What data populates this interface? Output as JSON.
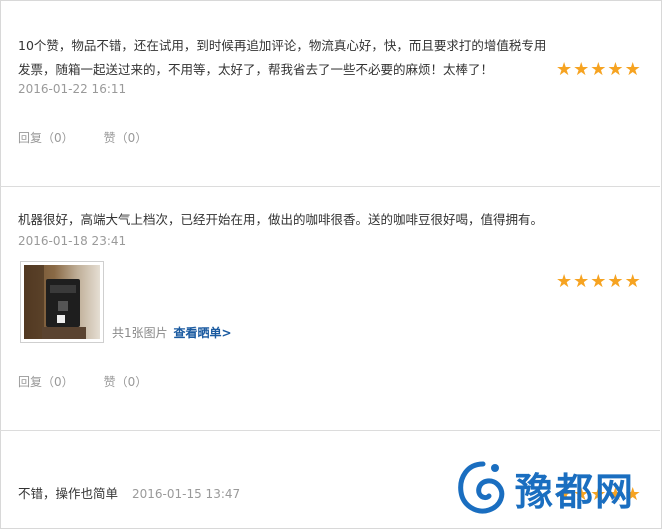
{
  "reviews": [
    {
      "text": "10个赞，物品不错，还在试用，到时候再追加评论，物流真心好，快，而且要求打的增值税专用发票，随箱一起送过来的，不用等，太好了，帮我省去了一些不必要的麻烦！太棒了！",
      "date": "2016-01-22 16:11",
      "rating": 5,
      "reply_label": "回复（0）",
      "like_label": "赞（0）"
    },
    {
      "text": "机器很好，高端大气上档次，已经开始在用，做出的咖啡很香。送的咖啡豆很好喝，值得拥有。",
      "date": "2016-01-18 23:41",
      "rating": 5,
      "photo_count": "共1张图片",
      "view_photos": "查看晒单",
      "reply_label": "回复（0）",
      "like_label": "赞（0）"
    },
    {
      "text": "不错，操作也简单",
      "date": "2016-01-15 13:47",
      "rating": 5
    }
  ],
  "watermark": {
    "text": "豫都网",
    "color": "#1a6ec0"
  },
  "colors": {
    "star": "#f6a321",
    "link": "#1a5aa0",
    "muted": "#9a9a9a"
  }
}
